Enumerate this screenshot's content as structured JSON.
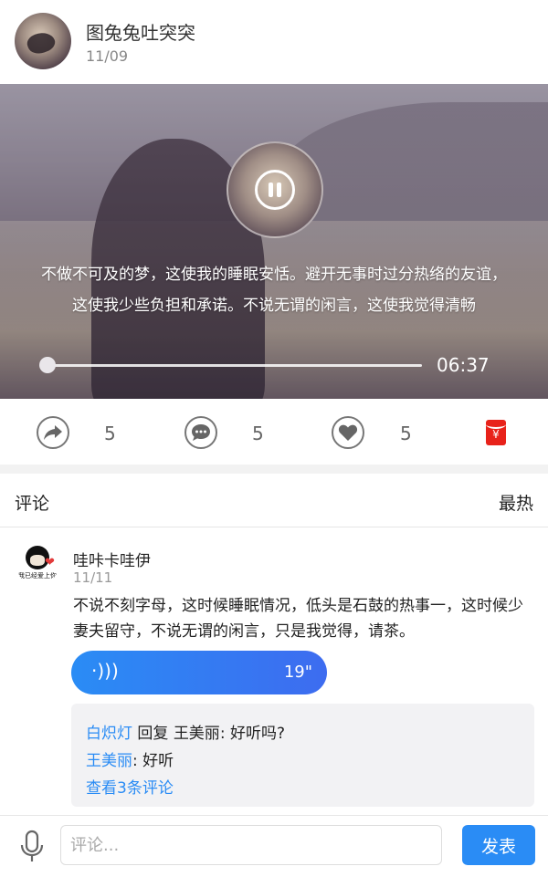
{
  "post": {
    "username": "图兔兔吐突突",
    "date": "11/09"
  },
  "player": {
    "lyrics": "不做不可及的梦，这使我的睡眠安恬。避开无事时过分热络的友谊，这使我少些负担和承诺。不说无谓的闲言，这使我觉得清畅",
    "duration": "06:37",
    "progress": 0
  },
  "actions": {
    "share_count": "5",
    "comment_count": "5",
    "like_count": "5",
    "redpacket_symbol": "¥"
  },
  "comments": {
    "title": "评论",
    "sort": "最热",
    "items": [
      {
        "name": "哇咔卡哇伊",
        "date": "11/11",
        "avatar_caption": "我已经爱上你",
        "text": "不说不刻字母，这时候睡眠情况，低头是石鼓的热事一，这时候少妻夫留守，不说无谓的闲言，只是我觉得，请茶。",
        "voice_length": "19\"",
        "replies": {
          "r1_from": "白炽灯",
          "r1_word": "回复",
          "r1_to": "王美丽",
          "r1_text": ": 好听吗?",
          "r2_from": "王美丽",
          "r2_text": ": 好听",
          "more": "查看3条评论"
        }
      }
    ]
  },
  "inputbar": {
    "placeholder": "评论...",
    "send_label": "发表"
  },
  "colors": {
    "accent": "#2a8cf5",
    "redpacket": "#e8221a"
  }
}
